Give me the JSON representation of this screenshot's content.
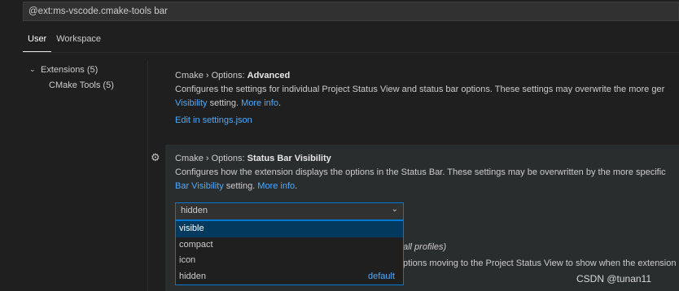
{
  "search": {
    "value": "@ext:ms-vscode.cmake-tools bar"
  },
  "tabs": [
    {
      "label": "User"
    },
    {
      "label": "Workspace"
    }
  ],
  "toc": {
    "extensions": "Extensions (5)",
    "cmake_tools": "CMake Tools (5)"
  },
  "settings": [
    {
      "category": "Cmake › Options: ",
      "name": "Advanced",
      "desc_line1": "Configures the settings for individual Project Status View and status bar options. These settings may overwrite the more ger",
      "desc_line2_link": "Visibility",
      "desc_line2_text": " setting. ",
      "more_info": "More info",
      "desc_line2_end": ".",
      "edit_link": "Edit in settings.json"
    },
    {
      "category": "Cmake › Options: ",
      "name": "Status Bar Visibility",
      "desc_line1": "Configures how the extension displays the options in the Status Bar. These settings may be overwritten by the more specific",
      "desc_line2_link": "Bar Visibility",
      "desc_line2_text": " setting. ",
      "more_info": "More info",
      "desc_line2_end": ".",
      "selected_value": "hidden",
      "options": [
        "visible",
        "compact",
        "icon",
        "hidden"
      ],
      "default_label": "default"
    }
  ],
  "behind": {
    "line1": "all profiles)",
    "line2": "ptions moving to the Project Status View to show when the extension"
  },
  "watermark": "CSDN @tunan11"
}
